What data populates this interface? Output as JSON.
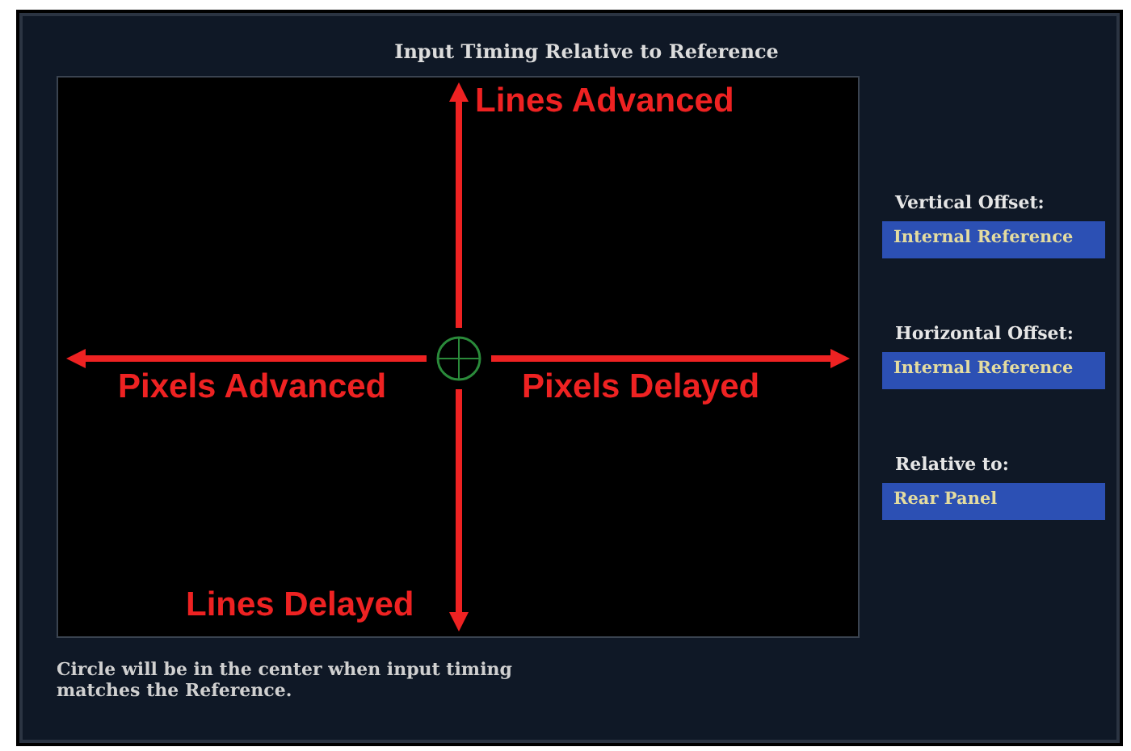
{
  "window": {
    "title": "Input Timing Relative to Reference"
  },
  "plot": {
    "labels": [
      {
        "kind": "up",
        "text": "Lines Advanced"
      },
      {
        "kind": "left",
        "text": "Pixels Advanced"
      },
      {
        "kind": "right",
        "text": "Pixels Delayed"
      },
      {
        "kind": "down",
        "text": "Lines Delayed"
      }
    ]
  },
  "fields": [
    {
      "label": "Vertical Offset:",
      "value": "Internal Reference"
    },
    {
      "label": "Horizontal Offset:",
      "value": "Internal Reference"
    },
    {
      "label": "Relative to:",
      "value": "Rear Panel"
    }
  ],
  "note": "Circle will be in the center when input timing matches the Reference."
}
